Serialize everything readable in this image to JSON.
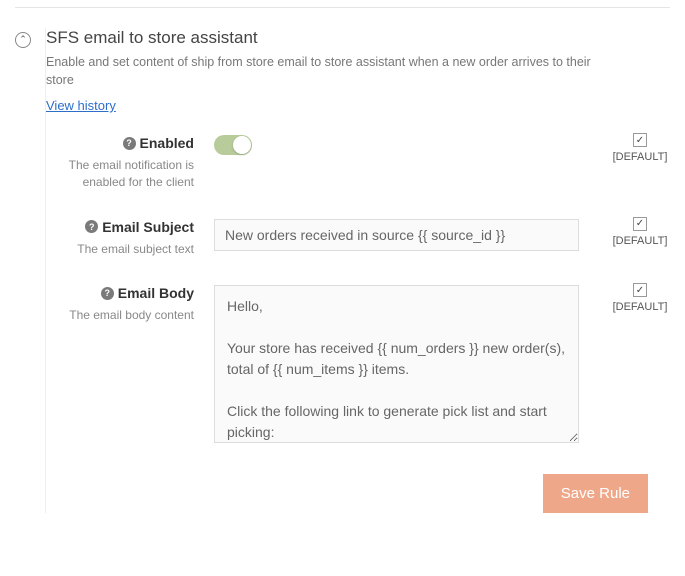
{
  "section": {
    "title": "SFS email to store assistant",
    "description": "Enable and set content of ship from store email to store assistant when a new order arrives to their store",
    "view_history": "View history"
  },
  "fields": {
    "enabled": {
      "label": "Enabled",
      "desc": "The email notification is enabled for the client",
      "default_label": "[DEFAULT]",
      "value": true
    },
    "subject": {
      "label": "Email Subject",
      "desc": "The email subject text",
      "value": "New orders received in source {{ source_id }}",
      "default_label": "[DEFAULT]"
    },
    "body": {
      "label": "Email Body",
      "desc": "The email body content",
      "value": "Hello,\n\nYour store has received {{ num_orders }} new order(s), total of {{ num_items }} items.\n\nClick the following link to generate pick list and start picking:",
      "default_label": "[DEFAULT]"
    }
  },
  "actions": {
    "save": "Save Rule"
  },
  "glyphs": {
    "check": "✓",
    "question": "?",
    "chevron_up": "⌃"
  }
}
